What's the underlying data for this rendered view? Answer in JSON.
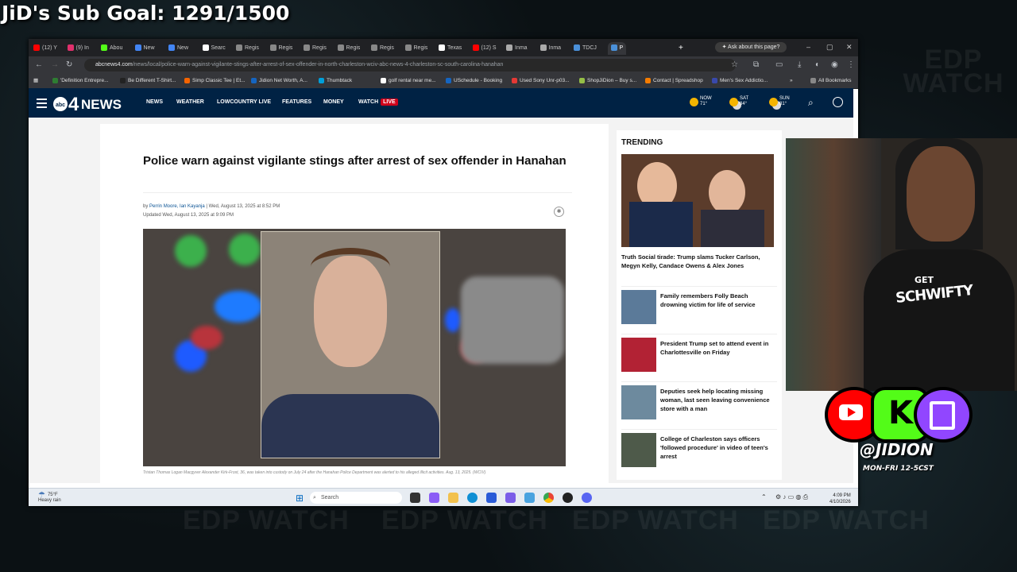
{
  "overlay": {
    "sub_goal": "JiD's Sub Goal: 1291/1500",
    "watermark": "EDP WATCH",
    "handle": "@JIDION",
    "schedule": "MON-FRI 12-5CST",
    "shirt_top": "GET",
    "shirt_main": "SCHWIFTY"
  },
  "browser": {
    "tabs": [
      {
        "label": "(12) Y",
        "color": "#ff0000"
      },
      {
        "label": "(9) In",
        "color": "#e1306c"
      },
      {
        "label": "Abou",
        "color": "#53fc18"
      },
      {
        "label": "New",
        "color": "#4285f4"
      },
      {
        "label": "New",
        "color": "#4285f4"
      },
      {
        "label": "Searc",
        "color": "#ffffff"
      },
      {
        "label": "Regis",
        "color": "#888888"
      },
      {
        "label": "Regis",
        "color": "#888888"
      },
      {
        "label": "Regis",
        "color": "#888888"
      },
      {
        "label": "Regis",
        "color": "#888888"
      },
      {
        "label": "Regis",
        "color": "#888888"
      },
      {
        "label": "Regis",
        "color": "#888888"
      },
      {
        "label": "Texas",
        "color": "#ffffff"
      },
      {
        "label": "(12) S",
        "color": "#ff0000"
      },
      {
        "label": "Inma",
        "color": "#aaaaaa"
      },
      {
        "label": "Inma",
        "color": "#aaaaaa"
      },
      {
        "label": "TDCJ",
        "color": "#4a90d9"
      },
      {
        "label": "P",
        "color": "#4a90d9"
      }
    ],
    "new_tab": "+",
    "ask_button": "Ask about this page?",
    "url_domain": "abcnews4.com",
    "url_path": "/news/local/police-warn-against-vigilante-stings-after-arrest-of-sex-offender-in-north-charleston-wciv-abc-news-4-charleston-sc-south-carolina-hanahan",
    "bookmarks": [
      {
        "label": "'Definition Entrepre...",
        "color": "#2e7d32"
      },
      {
        "label": "Be Different T-Shirt...",
        "color": "#222222"
      },
      {
        "label": "Simp Classic Tee | Et...",
        "color": "#f56400"
      },
      {
        "label": "Jidion Net Worth, A...",
        "color": "#1565c0"
      },
      {
        "label": "Thumbtack",
        "color": "#009fd9"
      },
      {
        "label": "golf rental near me...",
        "color": "#ffffff"
      },
      {
        "label": "USchedule - Booking",
        "color": "#1565c0"
      },
      {
        "label": "Used Sony Unr-p03...",
        "color": "#e53935"
      },
      {
        "label": "ShopJiDion – Buy s...",
        "color": "#95bf47"
      },
      {
        "label": "Contact | Spreadshop",
        "color": "#f57c00"
      },
      {
        "label": "Men's Sex Addictio...",
        "color": "#3949ab"
      }
    ],
    "all_bookmarks": "All Bookmarks"
  },
  "site": {
    "logo_text": "NEWS",
    "logo_num": "4",
    "logo_abc": "abc",
    "nav": [
      "NEWS",
      "WEATHER",
      "LOWCOUNTRY LIVE",
      "FEATURES",
      "MONEY",
      "WATCH"
    ],
    "live": "LIVE",
    "weather": [
      {
        "day": "NOW",
        "temp": "71°"
      },
      {
        "day": "SAT",
        "temp": "84°"
      },
      {
        "day": "SUN",
        "temp": "81°"
      }
    ]
  },
  "article": {
    "headline": "Police warn against vigilante stings after arrest of sex offender in Hanahan",
    "by": "by",
    "authors": "Perrin Moore, Ian Kayanja",
    "date": "| Wed, August 13, 2025 at 8:52 PM",
    "updated": "Updated Wed, August 13, 2025 at 9:09 PM",
    "caption": "Tristan Thomas Logan Macgyver Alexander Kirk-Frost, 36, was taken into custody on July 24 after the Hanahan Police Department was alerted to his alleged illicit activities. Aug. 13, 2025. (WCIV)"
  },
  "trending": {
    "heading": "TRENDING",
    "hero_caption": "Truth Social tirade: Trump slams Tucker Carlson, Megyn Kelly, Candace Owens & Alex Jones",
    "items": [
      {
        "title": "Family remembers Folly Beach drowning victim for life of service",
        "thumb": "#5b7a99"
      },
      {
        "title": "President Trump set to attend event in Charlottesville on Friday",
        "thumb": "#b22234"
      },
      {
        "title": "Deputies seek help locating missing woman, last seen leaving convenience store with a man",
        "thumb": "#6d8a9e"
      },
      {
        "title": "College of Charleston says officers 'followed procedure' in video of teen's arrest",
        "thumb": "#4e5a4a"
      }
    ]
  },
  "taskbar": {
    "weather_temp": "75°F",
    "weather_desc": "Heavy rain",
    "search": "Search",
    "time": "4:09 PM",
    "date": "4/10/2026"
  }
}
